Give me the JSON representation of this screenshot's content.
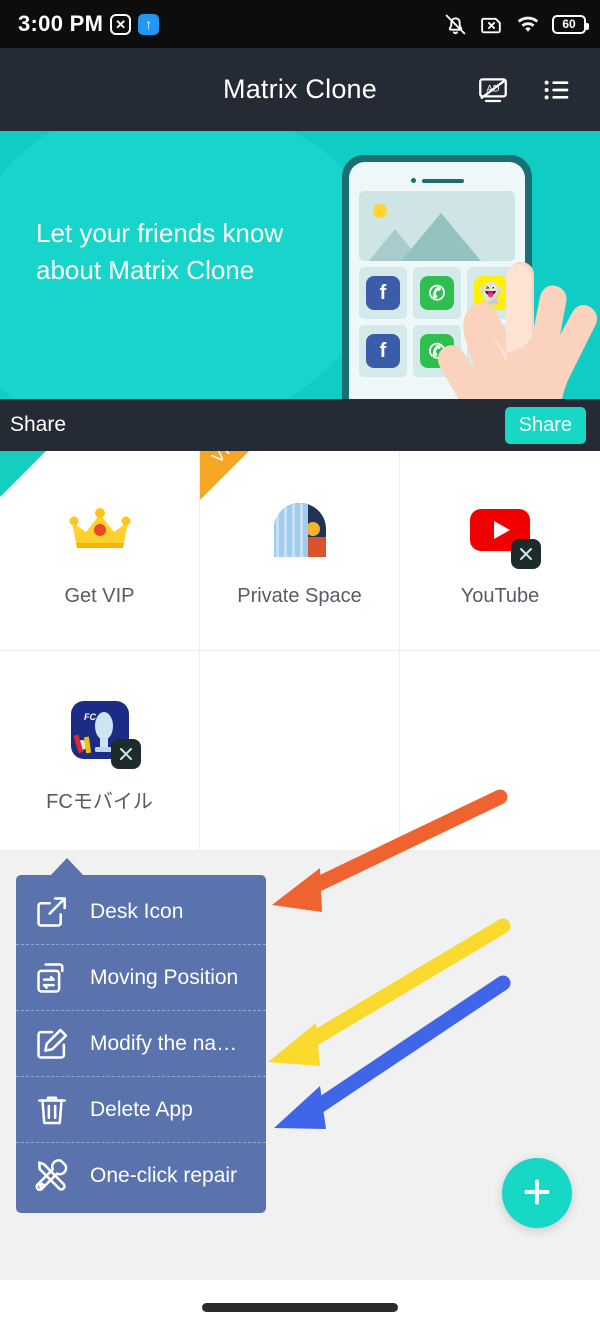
{
  "status_bar": {
    "time": "3:00 PM",
    "x_badge_icon": "x-circle-icon",
    "upload_arrow_icon": "upload-arrow-icon",
    "silent_icon": "bell-muted-icon",
    "sim_icon": "sim-card-off-icon",
    "wifi_icon": "wifi-icon",
    "battery_level": "60"
  },
  "appbar": {
    "title": "Matrix Clone",
    "no_ads_icon": "no-ads-icon",
    "list_icon": "list-menu-icon"
  },
  "banner": {
    "headline": "Let your friends know about Matrix Clone",
    "bg_color": "#0fcdc4",
    "illustration": "phone-hand-illustration",
    "mini_apps": [
      "facebook",
      "whatsapp",
      "snapchat",
      "facebook",
      "whatsapp",
      "snapchat"
    ]
  },
  "share_bar": {
    "label": "Share",
    "button_label": "Share",
    "button_color": "#16d8c4"
  },
  "grid": {
    "apps": [
      {
        "label": "Get VIP",
        "icon": "crown-icon",
        "badge_corner": "1",
        "corner_color": "#14cfc0",
        "ribbon": null,
        "has_clone_badge": false
      },
      {
        "label": "Private Space",
        "icon": "private-space-icon",
        "badge_corner": null,
        "ribbon": "VIP",
        "ribbon_color": "#f5a623",
        "has_clone_badge": false
      },
      {
        "label": "YouTube",
        "icon": "youtube-icon",
        "badge_corner": null,
        "ribbon": null,
        "has_clone_badge": true
      },
      {
        "label": "FCモバイル",
        "icon": "fc-mobile-icon",
        "badge_corner": null,
        "ribbon": null,
        "has_clone_badge": true
      }
    ]
  },
  "context_menu": {
    "bg_color": "#5a73ad",
    "items": [
      {
        "label": "Desk Icon",
        "icon": "external-link-icon"
      },
      {
        "label": "Moving Position",
        "icon": "move-swap-icon"
      },
      {
        "label": "Modify the na…",
        "icon": "edit-pencil-icon"
      },
      {
        "label": "Delete App",
        "icon": "trash-icon"
      },
      {
        "label": "One-click repair",
        "icon": "tools-repair-icon"
      }
    ]
  },
  "annotations": {
    "arrows": [
      {
        "name": "orange-arrow",
        "color": "#ef6331",
        "points_to": "Desk Icon"
      },
      {
        "name": "yellow-arrow",
        "color": "#fada2e",
        "points_to": "Modify the na…"
      },
      {
        "name": "blue-arrow",
        "color": "#4065e8",
        "points_to": "Delete App"
      }
    ]
  },
  "fab": {
    "icon": "plus-icon",
    "color": "#16d8c4"
  },
  "nav_bar": {
    "gesture_pill": "home-gesture-pill"
  }
}
